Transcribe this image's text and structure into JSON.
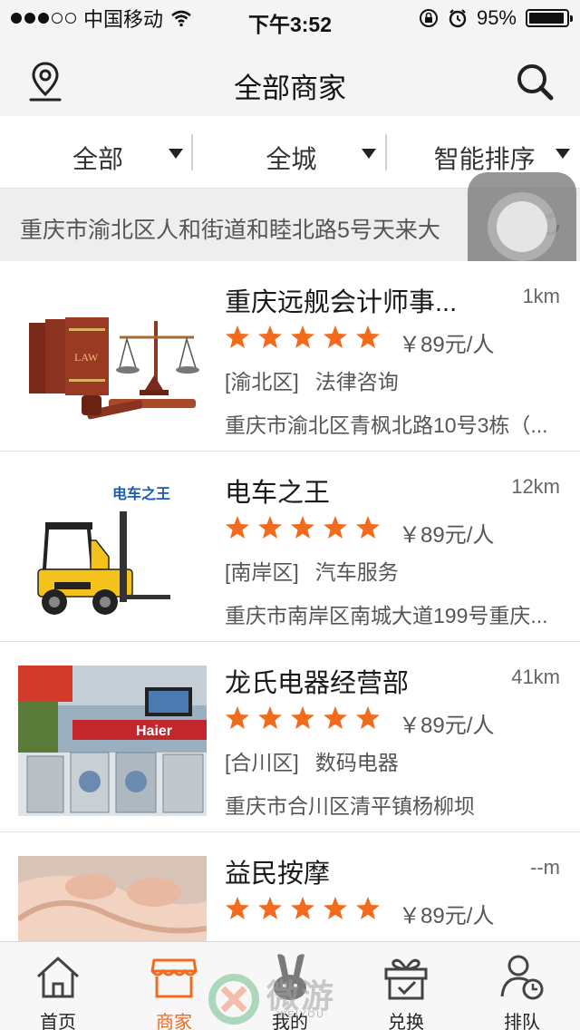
{
  "status_bar": {
    "carrier": "中国移动",
    "time": "下午3:52",
    "battery_percent": "95%",
    "battery_level": 0.95,
    "signal_bars": 2
  },
  "nav": {
    "title": "全部商家",
    "left_icon": "location-pin-icon",
    "right_icon": "search-icon"
  },
  "filters": [
    {
      "label": "全部"
    },
    {
      "label": "全城"
    },
    {
      "label": "智能排序"
    }
  ],
  "current_address": "重庆市渝北区人和街道和睦北路5号天来大",
  "colors": {
    "accent": "#f26b1d",
    "star": "#f26b1d",
    "background": "#f4f4f4"
  },
  "merchants": [
    {
      "name": "重庆远舰会计师事...",
      "distance": "1km",
      "rating": 5,
      "price": "￥89元/人",
      "district": "[渝北区]",
      "category": "法律咨询",
      "address": "重庆市渝北区青枫北路10号3栋（...",
      "image": "law-books-scales"
    },
    {
      "name": "电车之王",
      "distance": "12km",
      "rating": 5,
      "price": "￥89元/人",
      "district": "[南岸区]",
      "category": "汽车服务",
      "address": "重庆市南岸区南城大道199号重庆...",
      "image": "forklift",
      "logo_text": "电车之王"
    },
    {
      "name": "龙氏电器经营部",
      "distance": "41km",
      "rating": 5,
      "price": "￥89元/人",
      "district": "[合川区]",
      "category": "数码电器",
      "address": "重庆市合川区清平镇杨柳坝",
      "image": "appliance-store",
      "logo_text": "Haier"
    },
    {
      "name": "益民按摩",
      "distance": "--m",
      "rating": 5,
      "price": "￥89元/人",
      "district": "",
      "category": "",
      "address": "",
      "image": "massage"
    }
  ],
  "tabs": [
    {
      "label": "首页",
      "icon": "home-icon",
      "active": false
    },
    {
      "label": "商家",
      "icon": "shop-icon",
      "active": true
    },
    {
      "label": "我的",
      "icon": "user-icon",
      "active": false
    },
    {
      "label": "兑换",
      "icon": "gift-icon",
      "active": false
    },
    {
      "label": "排队",
      "icon": "queue-icon",
      "active": false
    }
  ],
  "watermark": {
    "text": "微游",
    "sub": "WEIYOU"
  }
}
